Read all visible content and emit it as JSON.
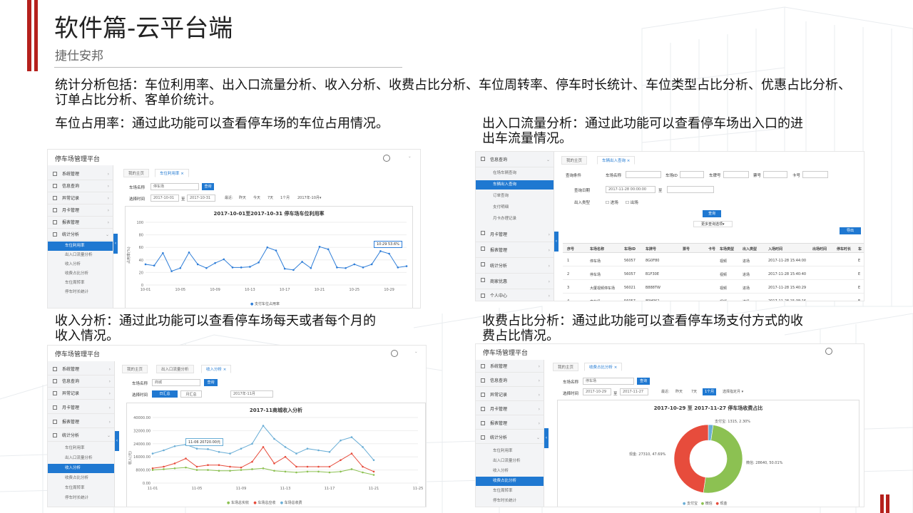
{
  "slide": {
    "title": "软件篇-云平台端",
    "subtitle": "捷仕安邦",
    "intro_line1": "统计分析包括：车位利用率、出入口流量分析、收入分析、收费占比分析、车位周转率、停车时长统计、车位类型占比分析、优惠占比分析、",
    "intro_line2": "订单占比分析、客单价统计。",
    "sec1_text": "车位占用率：通过此功能可以查看停车场的车位占用情况。",
    "sec2_line1": "出入口流量分析：通过此功能可以查看停车场出入口的进",
    "sec2_line2": "出车流量情况。",
    "sec3_line1": "收入分析：通过此功能可以查看停车场每天或者每个月的",
    "sec3_line2": "收入情况。",
    "sec4_line1": "收费占比分析：通过此功能可以查看停车场支付方式的收",
    "sec4_line2": "费占比情况。"
  },
  "s1": {
    "brand": "停车场管理平台",
    "nav": [
      "系统管理",
      "信息查询",
      "异常记录",
      "月卡管理",
      "报表管理",
      "统计分析"
    ],
    "sub": [
      "车位利用率",
      "出入口流量分析",
      "收入分析",
      "收费占比分析",
      "车位周转率",
      "停车时长统计"
    ],
    "tabs": [
      "我的主页",
      "车位利用率"
    ],
    "lbl_lot": "车场名称",
    "lot_value": "停车场",
    "btn_query": "查询",
    "lbl_time": "选择时间",
    "date_from": "2017-10-01",
    "date_sep": "至",
    "date_to": "2017-10-31",
    "quick": [
      "最近:",
      "昨天",
      "今天",
      "7天",
      "1个月"
    ],
    "month": "2017年-10月▾",
    "chart_title": "2017-10-01至2017-10-31 停车场车位利用率",
    "ylabel": "占用率(%)",
    "tooltip": "10:29 53.6%",
    "legend": "支付车位占用率"
  },
  "s2": {
    "nav": [
      "信息查询",
      "月卡管理",
      "报表管理",
      "统计分析",
      "商家优惠",
      "个人中心"
    ],
    "sub": [
      "在场车辆查询",
      "车辆出入查询",
      "订单查询",
      "支付明细",
      "月卡办理记录"
    ],
    "tabs": [
      "我的主页",
      "车辆出入查询"
    ],
    "f_cond": "查询条件",
    "f_lot": "车场名称",
    "f_lotid": "车场ID",
    "f_plate": "车牌号",
    "f_slot": "票号",
    "f_card": "卡号",
    "f_date": "查询日期",
    "date_from": "2017-11-28 00:00:00",
    "date_sep": "至",
    "f_type": "出入类型",
    "opt_in": "进场",
    "opt_out": "出场",
    "btn_query": "查询",
    "more": "更多查询选项▾",
    "btn_export": "导出",
    "columns": [
      "序号",
      "车场名称",
      "车场ID",
      "车牌号",
      "票号",
      "卡号",
      "车场类型",
      "出入类型",
      "入场时间",
      "出场时间",
      "停车时长",
      "车"
    ],
    "rows": [
      [
        "1",
        "停车场",
        "56057",
        "8G0F80",
        "",
        "",
        "视频",
        "进场",
        "2017-11-28 15:44:00",
        "",
        "",
        "E"
      ],
      [
        "2",
        "停车场",
        "56057",
        "B1F30E",
        "",
        "",
        "视频",
        "进场",
        "2017-11-28 15:40:40",
        "",
        "",
        "E"
      ],
      [
        "3",
        "大厦视频停车场",
        "56021",
        "B888TW",
        "",
        "",
        "视频",
        "进场",
        "2017-11-28 15:40:29",
        "",
        "",
        "E"
      ],
      [
        "4",
        "享车场",
        "56057",
        "89H9K1",
        "",
        "",
        "视频",
        "进场",
        "2017-11-28 15:38:16",
        "",
        "",
        "E"
      ]
    ]
  },
  "s3": {
    "brand": "停车场管理平台",
    "nav": [
      "系统管理",
      "信息查询",
      "异常记录",
      "月卡管理",
      "报表管理",
      "统计分析"
    ],
    "sub": [
      "车位利用率",
      "出入口流量分析",
      "收入分析",
      "收费占比分析",
      "车位周转率",
      "停车时长统计"
    ],
    "tabs": [
      "我的主页",
      "出入口流量分析",
      "收入分析"
    ],
    "lbl_lot": "车场名称",
    "lot_value": "商城",
    "btn_query": "查询",
    "lbl_time": "选择时间",
    "seg_day": "日汇总",
    "seg_month": "月汇总",
    "month": "2017年-11月",
    "chart_title": "2017-11商城收入分析",
    "ylabel": "收入(元)",
    "tooltip": "11-06 20720.00元",
    "legend": [
      "车场总实收",
      "车场总应收",
      "车场总收费"
    ]
  },
  "s4": {
    "brand": "停车场管理平台",
    "nav": [
      "系统管理",
      "信息查询",
      "异常记录",
      "月卡管理",
      "报表管理",
      "统计分析"
    ],
    "sub": [
      "车位利用率",
      "出入口流量分析",
      "收入分析",
      "收费占比分析",
      "车位周转率",
      "停车时长统计"
    ],
    "tabs": [
      "我的主页",
      "收费占比分析"
    ],
    "lbl_lot": "车场名称",
    "lot_value": "停车场",
    "btn_query": "查询",
    "lbl_time": "选择时间",
    "date_from": "2017-10-29",
    "date_sep": "至",
    "date_to": "2017-11-27",
    "quick": [
      "最近:",
      "昨天",
      "7天",
      "1个月"
    ],
    "month": "选择指定月 ▾",
    "chart_title": "2017-10-29 至 2017-11-27 停车场收费占比",
    "label_alipay": "支付宝: 1315, 2.30%",
    "label_wechat": "微信: 28640, 50.01%",
    "label_cash": "现金: 27310, 47.69%",
    "legend": [
      "支付宝",
      "微信",
      "现金"
    ]
  },
  "chart_data": [
    {
      "type": "line",
      "title": "2017-10-01至2017-10-31 停车场车位利用率",
      "ylabel": "占用率(%)",
      "x": [
        "10-01",
        "10-02",
        "10-03",
        "10-04",
        "10-05",
        "10-06",
        "10-07",
        "10-08",
        "10-09",
        "10-10",
        "10-11",
        "10-12",
        "10-13",
        "10-14",
        "10-15",
        "10-16",
        "10-17",
        "10-18",
        "10-19",
        "10-20",
        "10-21",
        "10-22",
        "10-23",
        "10-24",
        "10-25",
        "10-26",
        "10-27",
        "10-28",
        "10-29",
        "10-30",
        "10-31"
      ],
      "xticks": [
        "10-01",
        "10-05",
        "10-09",
        "10-13",
        "10-17",
        "10-21",
        "10-25",
        "10-29"
      ],
      "yticks": [
        0,
        20,
        40,
        60,
        80,
        100
      ],
      "ylim": [
        0,
        100
      ],
      "series": [
        {
          "name": "支付车位占用率",
          "values": [
            33,
            31,
            51,
            22,
            27,
            52,
            33,
            27,
            35,
            41,
            28,
            28,
            29,
            36,
            60,
            55,
            26,
            24,
            37,
            27,
            61,
            57,
            28,
            27,
            33,
            28,
            33,
            54,
            50,
            28,
            30
          ]
        }
      ],
      "color": "#2f7ed8"
    },
    {
      "type": "line",
      "title": "2017-11商城收入分析",
      "ylabel": "收入(元)",
      "x": [
        "11-01",
        "11-02",
        "11-03",
        "11-04",
        "11-05",
        "11-06",
        "11-07",
        "11-08",
        "11-09",
        "11-10",
        "11-11",
        "11-12",
        "11-13",
        "11-14",
        "11-15",
        "11-16",
        "11-17",
        "11-18",
        "11-19",
        "11-20",
        "11-21"
      ],
      "xticks": [
        "11-01",
        "11-05",
        "11-09",
        "11-13",
        "11-17",
        "11-21",
        "11-25"
      ],
      "yticks": [
        0,
        8000,
        16000,
        24000,
        32000,
        40000
      ],
      "ylim": [
        0,
        40000
      ],
      "series": [
        {
          "name": "车场总实收",
          "values": [
            18000,
            20000,
            22500,
            23500,
            21000,
            20720,
            19000,
            18000,
            21000,
            24000,
            35000,
            27000,
            22000,
            18000,
            21000,
            20000,
            19000,
            26000,
            28000,
            22000,
            14000
          ]
        },
        {
          "name": "车场总应收",
          "values": [
            9000,
            10000,
            12000,
            15000,
            10000,
            11000,
            11000,
            10000,
            9500,
            13000,
            22000,
            12000,
            16000,
            10000,
            10000,
            10000,
            10000,
            14000,
            18000,
            10000,
            7000
          ]
        },
        {
          "name": "车场总收费",
          "values": [
            8000,
            8500,
            9000,
            9500,
            8000,
            8000,
            7500,
            7500,
            8000,
            8500,
            9000,
            7500,
            7000,
            6500,
            7000,
            7000,
            6500,
            7000,
            8500,
            6500,
            5000
          ]
        }
      ],
      "colors": [
        "#8cc152",
        "#e74c3c",
        "#6aaed6"
      ]
    },
    {
      "type": "pie",
      "title": "2017-10-29 至 2017-11-27 停车场收费占比",
      "categories": [
        "支付宝",
        "微信",
        "现金"
      ],
      "values": [
        1315,
        28640,
        27310
      ],
      "percents": [
        2.3,
        50.01,
        47.69
      ],
      "colors": [
        "#6aaed6",
        "#8cc152",
        "#e74c3c"
      ]
    }
  ]
}
